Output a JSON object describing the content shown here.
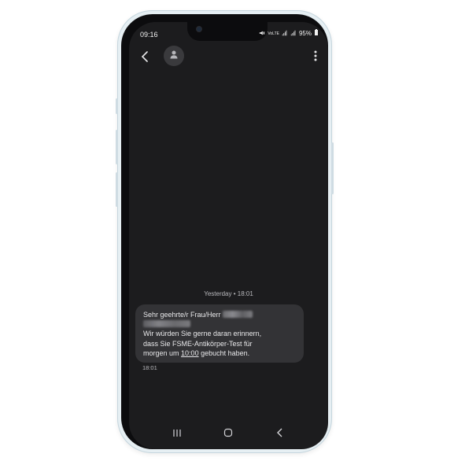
{
  "status_bar": {
    "time": "09:16",
    "network": "VoLTE",
    "battery": "95%",
    "icons": [
      "mute-icon",
      "volte-icon",
      "signal-icon",
      "signal-icon",
      "battery-icon"
    ]
  },
  "header": {
    "back_icon": "back-arrow-icon",
    "avatar_icon": "person-icon",
    "more_icon": "more-vertical-icon"
  },
  "conversation": {
    "date_separator": "Yesterday • 18:01",
    "messages": [
      {
        "line1_prefix": "Sehr geehrte/r Frau/Herr",
        "redacted_name": true,
        "body_line2": "Wir würden Sie gerne daran erinnern,",
        "body_line3": "dass Sie FSME-Antikörper-Test für",
        "body_line4_prefix": "morgen um",
        "body_time_link": "10:00",
        "body_line4_suffix": "gebucht haben.",
        "timestamp": "18:01"
      }
    ]
  },
  "navigation": {
    "recent_icon": "recent-apps-icon",
    "home_icon": "home-icon",
    "back_icon": "nav-back-icon"
  },
  "colors": {
    "screen_bg": "#1c1c1e",
    "bubble_bg": "#333336",
    "text": "#e8e8ea",
    "subtle_text": "#b9b9bd",
    "frame": "#e6eff3"
  }
}
